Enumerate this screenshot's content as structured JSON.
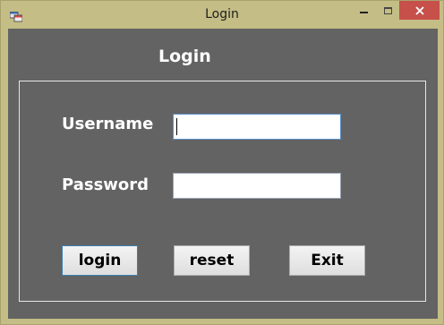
{
  "window": {
    "title": "Login",
    "controls": {
      "minimize_icon": "minimize-icon",
      "maximize_icon": "maximize-icon",
      "close_glyph": "✕"
    },
    "colors": {
      "frame": "#c4bd85",
      "client": "#636363",
      "close": "#c7504a"
    }
  },
  "form": {
    "heading": "Login",
    "username_label": "Username",
    "username_value": "",
    "password_label": "Password",
    "password_value": ""
  },
  "buttons": {
    "login": "login",
    "reset": "reset",
    "exit": "Exit"
  }
}
